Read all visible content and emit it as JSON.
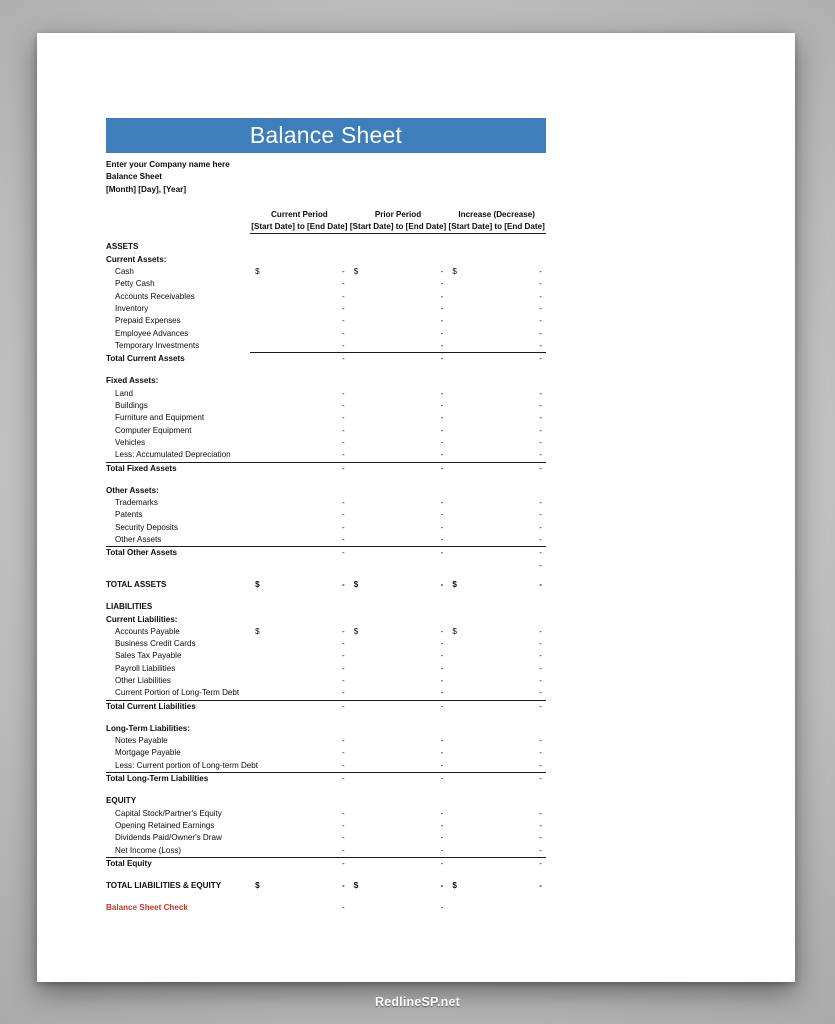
{
  "banner": {
    "title": "Balance Sheet"
  },
  "heading": {
    "company": "Enter your Company name here",
    "document": "Balance Sheet",
    "date": "[Month] [Day], [Year]"
  },
  "columns": [
    {
      "title": "Current Period",
      "range": "[Start Date] to [End Date]"
    },
    {
      "title": "Prior Period",
      "range": "[Start Date] to [End Date]"
    },
    {
      "title": "Increase (Decrease)",
      "range": "[Start Date] to [End Date]"
    }
  ],
  "currency_symbol": "$",
  "dash": "-",
  "colors": {
    "banner_blue": "#3D7EBB",
    "check_red": "#C0392B",
    "page_white": "#FFFFFF",
    "rule_black": "#1A1A1A"
  },
  "sections": {
    "assets_header": "ASSETS",
    "current_assets_header": "Current Assets:",
    "current_assets": [
      "Cash",
      "Petty Cash",
      "Accounts Receivables",
      "Inventory",
      "Prepaid Expenses",
      "Employee Advances",
      "Temporary Investments"
    ],
    "total_current_assets": "Total Current Assets",
    "fixed_assets_header": "Fixed Assets:",
    "fixed_assets": [
      "Land",
      "Buildings",
      "Furniture and Equipment",
      "Computer Equipment",
      "Vehicles",
      "Less: Accumulated Depreciation"
    ],
    "total_fixed_assets": "Total Fixed Assets",
    "other_assets_header": "Other Assets:",
    "other_assets": [
      "Trademarks",
      "Patents",
      "Security Deposits",
      "Other Assets"
    ],
    "total_other_assets": "Total Other Assets",
    "total_assets": "TOTAL ASSETS",
    "liabilities_header": "LIABILITIES",
    "current_liabilities_header": "Current Liabilities:",
    "current_liabilities": [
      "Accounts Payable",
      "Business Credit Cards",
      "Sales Tax Payable",
      "Payroll Liabilities",
      "Other Liabilities",
      "Current Portion of Long-Term Debt"
    ],
    "total_current_liabilities": "Total Current Liabilities",
    "long_term_liabilities_header": "Long-Term Liabilities:",
    "long_term_liabilities": [
      "Notes Payable",
      "Mortgage Payable",
      "Less: Current portion of Long-term Debt"
    ],
    "total_long_term_liabilities": "Total Long-Term Liabilities",
    "equity_header": "EQUITY",
    "equity": [
      "Capital Stock/Partner's Equity",
      "Opening Retained Earnings",
      "Dividends Paid/Owner's Draw",
      "Net Income (Loss)"
    ],
    "total_equity": "Total Equity",
    "total_liabilities_equity": "TOTAL LIABILITIES & EQUITY",
    "balance_sheet_check": "Balance Sheet Check"
  },
  "watermark": "RedlineSP.net"
}
